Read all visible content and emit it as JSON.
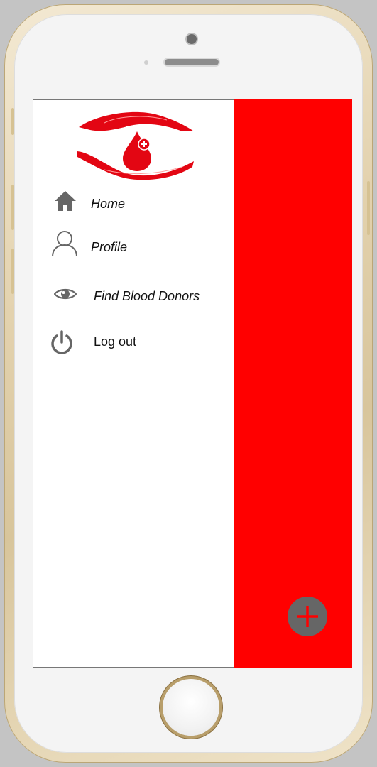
{
  "drawer": {
    "items": [
      {
        "label": "Home",
        "icon": "home-icon"
      },
      {
        "label": "Profile",
        "icon": "person-icon"
      },
      {
        "label": "Find Blood Donors",
        "icon": "eye-icon"
      },
      {
        "label": "Log out",
        "icon": "power-icon"
      }
    ]
  },
  "colors": {
    "accent": "#ff0000",
    "icon": "#666666",
    "drawer_bg": "#ffffff"
  },
  "fab": {
    "icon": "plus-icon"
  }
}
